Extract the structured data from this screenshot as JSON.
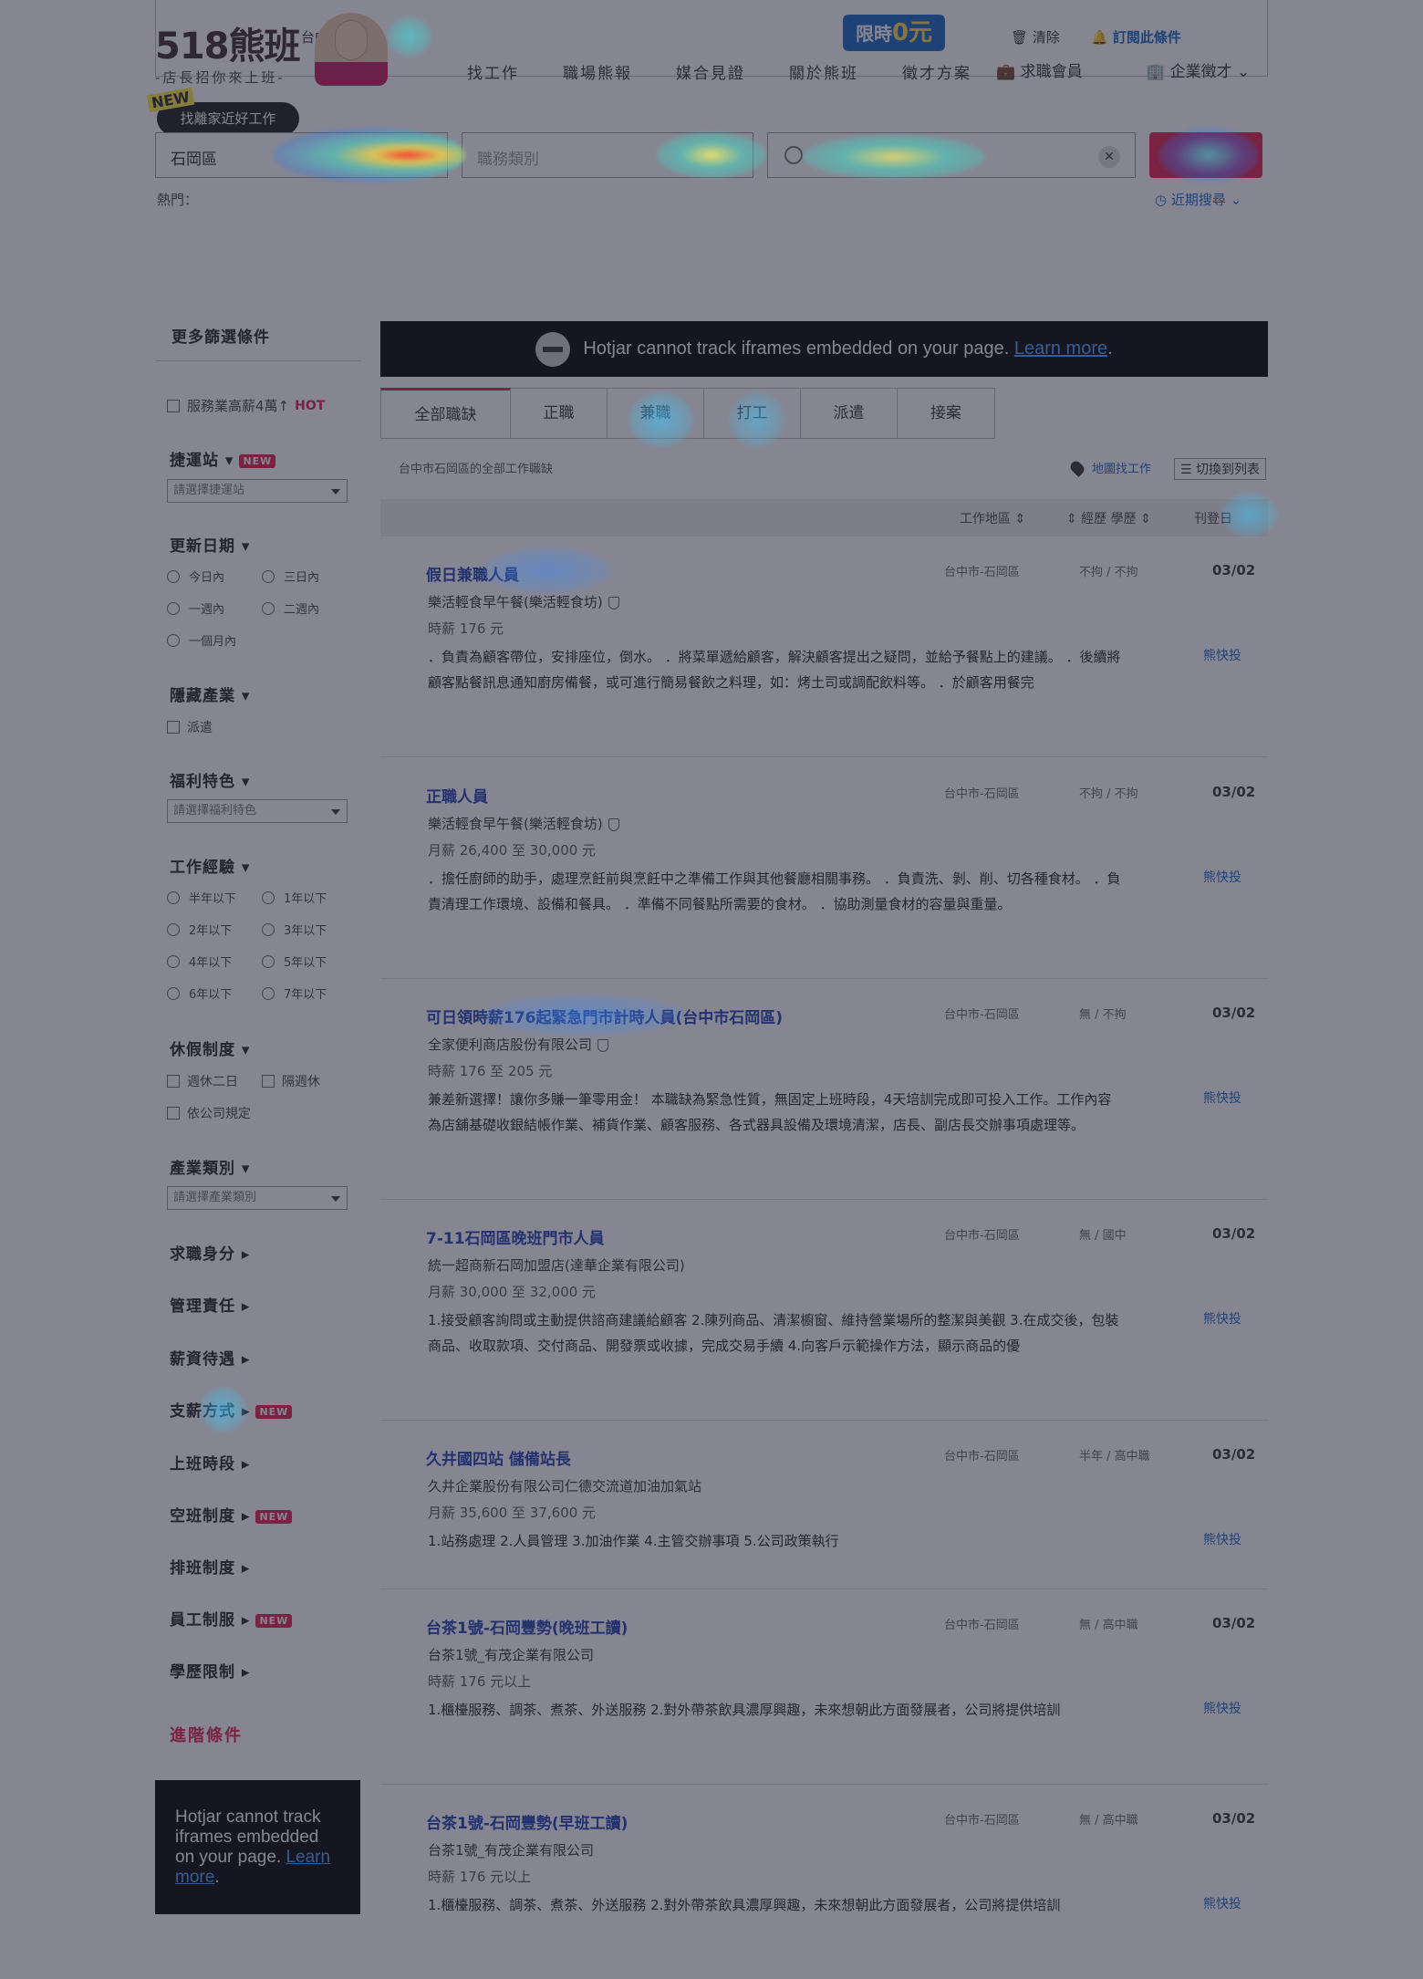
{
  "header": {
    "logo": "518熊班",
    "logo_tagline": "-店長招你來上班-",
    "region_prefix": "台中",
    "promo_text": "限時",
    "promo_value": "0元",
    "clear_label": "清除",
    "subscribe_label": "訂閱此條件",
    "nav": [
      "找工作",
      "職場熊報",
      "媒合見證",
      "關於熊班",
      "徵才方案"
    ],
    "member_label": "求職會員",
    "employer_label": "企業徵才"
  },
  "search": {
    "new_tag": "NEW",
    "near_label": "找離家近好工作",
    "location_value": "石岡區",
    "category_placeholder": "職務類別",
    "keyword_value": "",
    "hot_label": "熱門：",
    "recent_label": "近期搜尋"
  },
  "sidebar": {
    "title": "更多篩選條件",
    "high_salary": "服務業高薪4萬↑",
    "high_salary_badge": "HOT",
    "station_heading": "捷運站 ▾",
    "station_select": "請選擇捷運站",
    "update_heading": "更新日期 ▾",
    "update_opts": [
      "今日內",
      "三日內",
      "一週內",
      "二週內",
      "一個月內"
    ],
    "hidden_heading": "隱藏產業 ▾",
    "hidden_opt": "派遣",
    "benefit_heading": "福利特色 ▾",
    "benefit_select": "請選擇福利特色",
    "exp_heading": "工作經驗 ▾",
    "exp_opts": [
      "半年以下",
      "1年以下",
      "2年以下",
      "3年以下",
      "4年以下",
      "5年以下",
      "6年以下",
      "7年以下"
    ],
    "leave_heading": "休假制度 ▾",
    "leave_opts": [
      "週休二日",
      "隔週休",
      "依公司規定"
    ],
    "industry_heading": "產業類別 ▾",
    "industry_select": "請選擇產業類別",
    "collapsed": [
      "求職身分 ▸",
      "管理責任 ▸",
      "薪資待遇 ▸",
      "支薪方式 ▸",
      "上班時段 ▸",
      "空班制度 ▸",
      "排班制度 ▸",
      "員工制服 ▸",
      "學歷限制 ▸"
    ],
    "new_badge": "NEW",
    "advanced": "進階條件",
    "hotjar_text": "Hotjar cannot track iframes embedded on your page.",
    "hotjar_link": "Learn more"
  },
  "main": {
    "hotjar_text": "Hotjar cannot track iframes embedded on your page.",
    "hotjar_link": "Learn more",
    "tabs": [
      "全部職缺",
      "正職",
      "兼職",
      "打工",
      "派遣",
      "接案"
    ],
    "crumb": "台中市石岡區的全部工作職缺",
    "map_link": "地圖找工作",
    "switch_label": "切換到列表",
    "col_location": "工作地區 ⇕",
    "col_exp": "⇕ 經歷  學歷 ⇕",
    "col_date": "刊登日",
    "apply_label": "熊快投",
    "jobs": [
      {
        "title": "假日兼職人員",
        "company": "樂活輕食早午餐(樂活輕食坊)",
        "salary": "時薪 176 元",
        "desc": "．負責為顧客帶位，安排座位，倒水。 ．將菜單遞給顧客，解決顧客提出之疑問，並給予餐點上的建議。 ．後續將顧客點餐訊息通知廚房備餐，或可進行簡易餐飲之料理，如：烤土司或調配飲料等。 ．於顧客用餐完",
        "location": "台中市-石岡區",
        "exp": "不拘 / 不拘",
        "date": "03/02"
      },
      {
        "title": "正職人員",
        "company": "樂活輕食早午餐(樂活輕食坊)",
        "salary": "月薪 26,400 至 30,000 元",
        "desc": "．擔任廚師的助手，處理烹飪前與烹飪中之準備工作與其他餐廳相關事務。 ．負責洗、剝、削、切各種食材。 ．負責清理工作環境、設備和餐具。 ．準備不同餐點所需要的食材。 ．協助測量食材的容量與重量。",
        "location": "台中市-石岡區",
        "exp": "不拘 / 不拘",
        "date": "03/02"
      },
      {
        "title": "可日領時薪176起緊急門市計時人員(台中市石岡區)",
        "company": "全家便利商店股份有限公司",
        "salary": "時薪 176 至 205 元",
        "desc": "兼差新選擇！讓你多賺一筆零用金！ 本職缺為緊急性質，無固定上班時段，4天培訓完成即可投入工作。工作內容為店舖基礎收銀結帳作業、補貨作業、顧客服務、各式器具設備及環境清潔，店長、副店長交辦事項處理等。",
        "location": "台中市-石岡區",
        "exp": "無 / 不拘",
        "date": "03/02"
      },
      {
        "title": "7-11石岡區晚班門市人員",
        "company": "統一超商新石岡加盟店(達華企業有限公司)",
        "salary": "月薪 30,000 至 32,000 元",
        "desc": "1.接受顧客詢問或主動提供諮商建議給顧客 2.陳列商品、清潔櫥窗、維持營業場所的整潔與美觀 3.在成交後，包裝商品、收取款項、交付商品、開發票或收據，完成交易手續 4.向客戶示範操作方法，顯示商品的優",
        "location": "台中市-石岡區",
        "exp": "無 / 國中",
        "date": "03/02"
      },
      {
        "title": "久井國四站 儲備站長",
        "company": "久井企業股份有限公司仁德交流道加油加氣站",
        "salary": "月薪 35,600 至 37,600 元",
        "desc": "1.站務處理 2.人員管理 3.加油作業 4.主管交辦事項 5.公司政策執行",
        "location": "台中市-石岡區",
        "exp": "半年 / 高中職",
        "date": "03/02"
      },
      {
        "title": "台茶1號-石岡豐勢(晚班工讀)",
        "company": "台茶1號_有茂企業有限公司",
        "salary": "時薪 176 元以上",
        "desc": "1.櫃檯服務、調茶、煮茶、外送服務 2.對外帶茶飲具濃厚興趣，未來想朝此方面發展者，公司將提供培訓",
        "location": "台中市-石岡區",
        "exp": "無 / 高中職",
        "date": "03/02"
      },
      {
        "title": "台茶1號-石岡豐勢(早班工讀)",
        "company": "台茶1號_有茂企業有限公司",
        "salary": "時薪 176 元以上",
        "desc": "1.櫃檯服務、調茶、煮茶、外送服務 2.對外帶茶飲具濃厚興趣，未來想朝此方面發展者，公司將提供培訓",
        "location": "台中市-石岡區",
        "exp": "無 / 高中職",
        "date": "03/02"
      }
    ]
  }
}
